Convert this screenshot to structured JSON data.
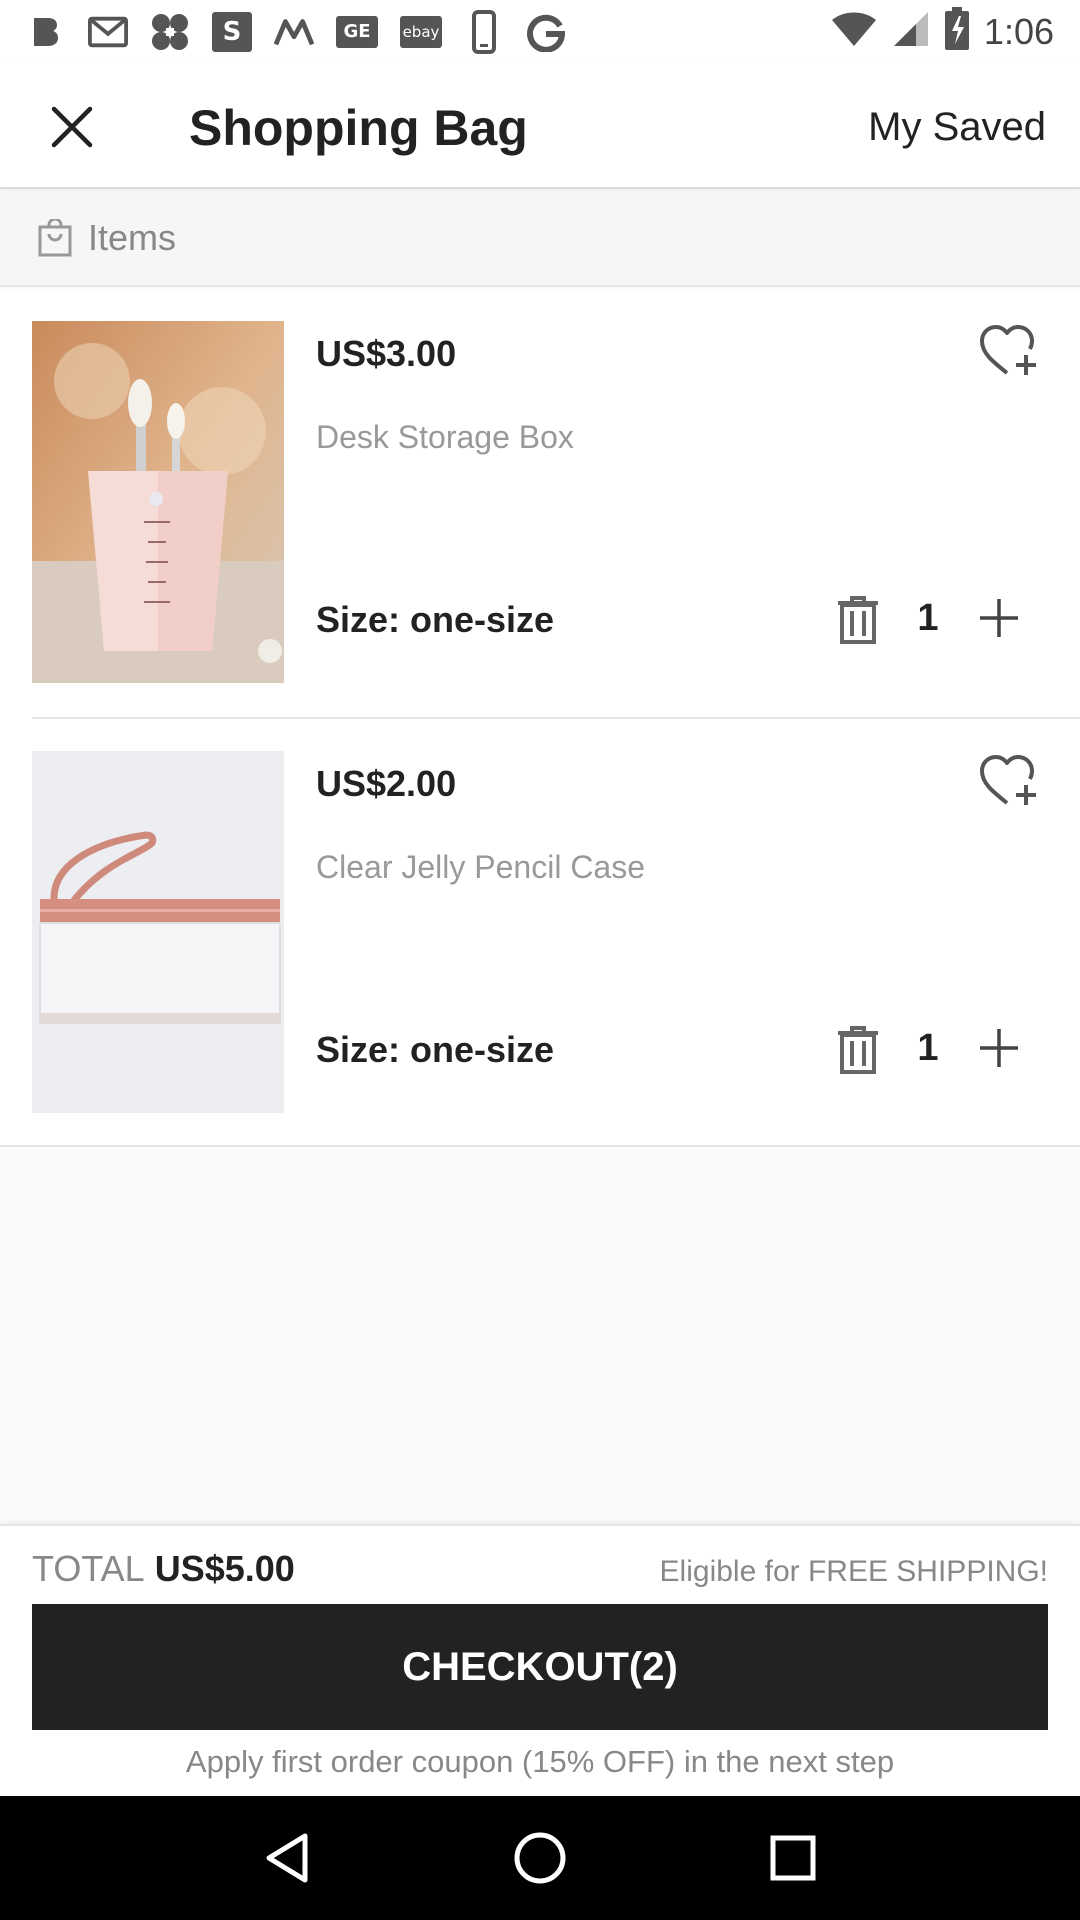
{
  "status_bar": {
    "time": "1:06",
    "icons": [
      "b-icon",
      "gmail-icon",
      "app-icon",
      "s-icon",
      "m-icon",
      "ge-icon",
      "ebay-icon",
      "phone-icon",
      "g-icon"
    ],
    "s_label": "S",
    "ge_label": "GE",
    "ebay_label": "ebay"
  },
  "header": {
    "title": "Shopping Bag",
    "saved_label": "My Saved"
  },
  "items_section": {
    "label": "Items"
  },
  "products": [
    {
      "price": "US$3.00",
      "name": "Desk Storage Box",
      "size": "Size: one-size",
      "quantity": "1"
    },
    {
      "price": "US$2.00",
      "name": "Clear Jelly Pencil Case",
      "size": "Size: one-size",
      "quantity": "1"
    }
  ],
  "footer": {
    "total_label": "TOTAL",
    "total_value": "US$5.00",
    "shipping_note": "Eligible for FREE SHIPPING!",
    "checkout_label": "CHECKOUT(2)",
    "coupon_note": "Apply first order coupon (15% OFF) in the next step"
  },
  "colors": {
    "button_dark": "#222222",
    "muted_text": "#888888",
    "divider": "#e4e4e4"
  }
}
